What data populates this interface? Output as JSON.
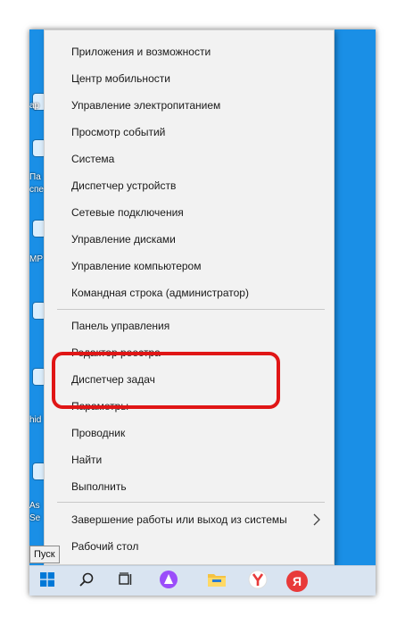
{
  "desktop": {
    "icon_labels": [
      "ар",
      "Па",
      "спе",
      "MP",
      "hid",
      "As",
      "Se"
    ]
  },
  "menu": {
    "items": [
      {
        "label": "Приложения и возможности"
      },
      {
        "label": "Центр мобильности"
      },
      {
        "label": "Управление электропитанием"
      },
      {
        "label": "Просмотр событий"
      },
      {
        "label": "Система"
      },
      {
        "label": "Диспетчер устройств"
      },
      {
        "label": "Сетевые подключения"
      },
      {
        "label": "Управление дисками"
      },
      {
        "label": "Управление компьютером"
      },
      {
        "label": "Командная строка (администратор)"
      },
      {
        "label": "Панель управления"
      },
      {
        "label": "Редактор реестра"
      },
      {
        "label": "Диспетчер задач"
      },
      {
        "label": "Параметры"
      },
      {
        "label": "Проводник"
      },
      {
        "label": "Найти"
      },
      {
        "label": "Выполнить"
      },
      {
        "label": "Завершение работы или выход из системы"
      },
      {
        "label": "Рабочий стол"
      }
    ],
    "highlighted_item": "Диспетчер задач",
    "highlight_color": "#e01616"
  },
  "tooltip": {
    "text": "Пуск"
  },
  "taskbar": {
    "background": "#d9e4f1",
    "buttons": [
      {
        "name": "start",
        "icon": "windows-logo-icon"
      },
      {
        "name": "search",
        "icon": "search-icon"
      },
      {
        "name": "task-view",
        "icon": "task-view-icon"
      },
      {
        "name": "alice",
        "icon": "alice-icon"
      },
      {
        "name": "explorer",
        "icon": "folder-icon"
      },
      {
        "name": "yandex-browser",
        "icon": "yandex-browser-icon"
      },
      {
        "name": "yandex",
        "icon": "yandex-icon",
        "label": "Я"
      }
    ]
  },
  "colors": {
    "desktop": "#1a8fe6",
    "menu_bg": "#f2f2f2",
    "windows_blue": "#0078d7",
    "alice_purple": "#9b4dfa",
    "yandex_red": "#e83a3a"
  }
}
